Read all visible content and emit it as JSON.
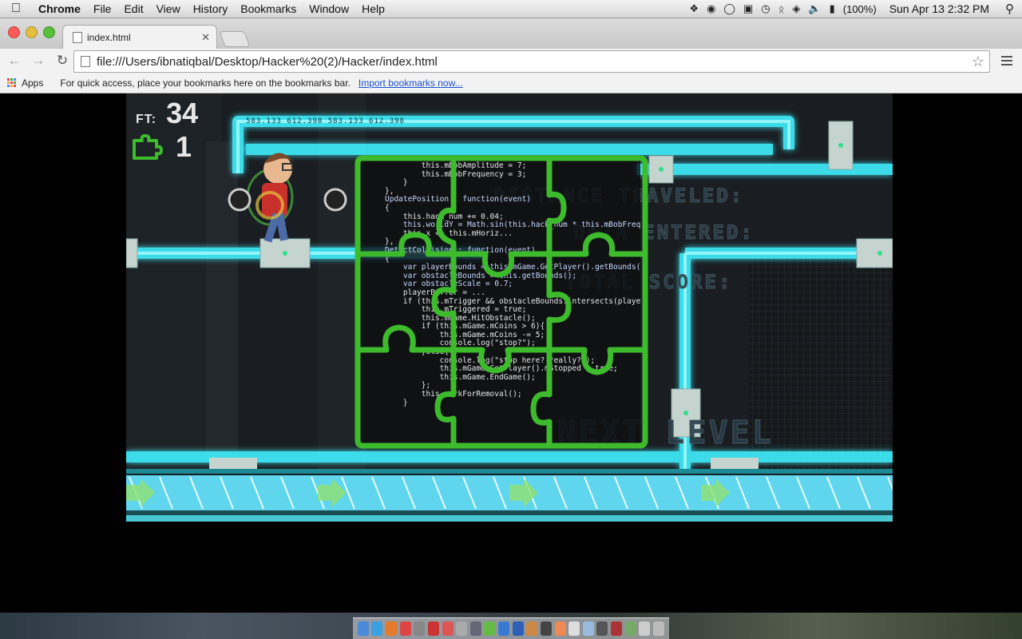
{
  "menubar": {
    "app_name": "Chrome",
    "items": [
      "File",
      "Edit",
      "View",
      "History",
      "Bookmarks",
      "Window",
      "Help"
    ],
    "battery": "(100%)",
    "datetime": "Sun Apr 13  2:32 PM"
  },
  "browser": {
    "tab_title": "index.html",
    "url": "file:///Users/ibnatiqbal/Desktop/Hacker%20(2)/Hacker/index.html",
    "bookmarks_apps": "Apps",
    "bookmarks_hint": "For quick access, place your bookmarks here on the bookmarks bar.",
    "bookmarks_import": "Import bookmarks now..."
  },
  "game": {
    "ft_label": "FT:",
    "ft_value": "34",
    "puzzle_count": "1",
    "ghost_distance": "DISTANCE TRAVELED:",
    "ghost_data": "DATA ENTERED:",
    "ghost_total": "TOTAL SCORE:",
    "ghost_next": "NEXT LEVEL",
    "pipe_numbers": "583.133  612.398  583.133  612.398",
    "code_lines": [
      "        this.mBobAmplitude = 7;",
      "        this.mBobFrequency = 3;",
      "    }",
      "",
      "},",
      "",
      "UpdatePosition : function(event)",
      "{",
      "    this.hack_num += 0.04;",
      "    this.worldY = Math.sin(this.hack_num * this.mBobFrequenc",
      "    this.x += this.mHoriz...",
      "},",
      "",
      "DetectCollision : function(event)",
      "{",
      "",
      "    var playerBounds = this.mGame.GetPlayer().getBounds();",
      "    var obstacleBounds = this.getBounds();",
      "    var obstacleScale = 0.7;",
      "    playerBuffer = ...",
      "    if (this.mTrigger && obstacleBounds.intersects(playerB",
      "        this.mTriggered = true;",
      "        this.mGame.HitObstacle();",
      "        if (this.mGame.mCoins > 6){",
      "            this.mGame.mCoins -= 5;",
      "            console.log(\"stop?\");",
      "        }else{",
      "            console.log(\"stop here? really?\");",
      "            this.mGame.GetPlayer().mStopped = true;",
      "            this.mGame.EndGame();",
      "        };",
      "        this.markForRemoval();",
      "    }"
    ],
    "colors": {
      "neon_cyan": "#3ff0ff",
      "puzzle_green": "#3dbb2c",
      "floor_cyan": "#5fd6ee",
      "arrow_green": "#8ee07a"
    }
  }
}
